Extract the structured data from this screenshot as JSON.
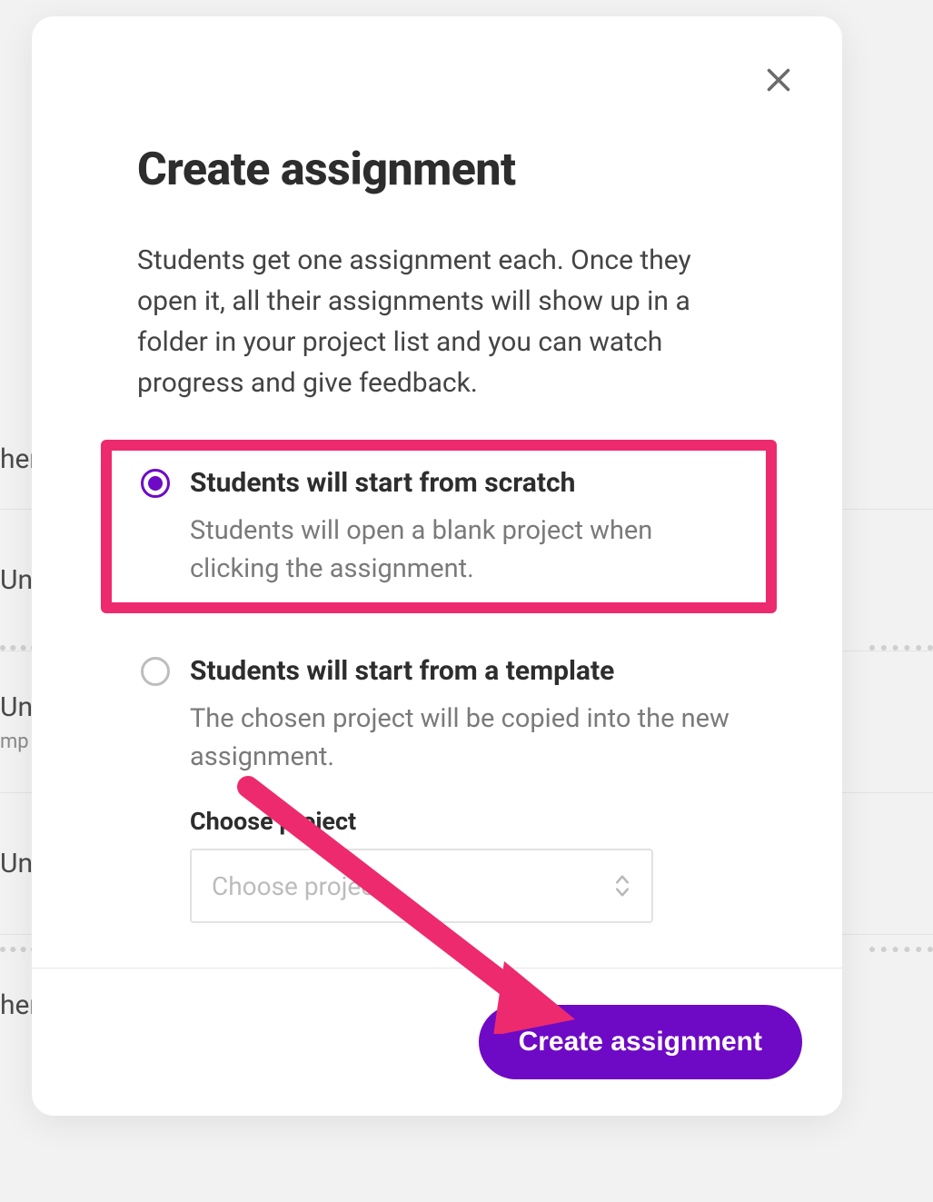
{
  "background": {
    "rows": [
      {
        "title": "her",
        "sub": ""
      },
      {
        "title": "Unt",
        "sub": ""
      },
      {
        "title": "Unt",
        "sub": "mp"
      },
      {
        "title": "Unt",
        "sub": ""
      },
      {
        "title": "her",
        "sub": ""
      }
    ]
  },
  "modal": {
    "close_label": "Close",
    "title": "Create assignment",
    "description": "Students get one assignment each. Once they open it, all their assignments will show up in a folder in your project list and you can watch progress and give feedback.",
    "options": [
      {
        "id": "scratch",
        "title": "Students will start from scratch",
        "description": "Students will open a blank project when clicking the assignment.",
        "selected": true,
        "highlighted": true
      },
      {
        "id": "template",
        "title": "Students will start from a template",
        "description": "The chosen project will be copied into the new assignment.",
        "selected": false,
        "highlighted": false,
        "field_label": "Choose project",
        "select_placeholder": "Choose project..."
      }
    ],
    "primary_button": "Create assignment"
  },
  "annotation": {
    "highlight_color": "#ed2a6e",
    "arrow_color": "#ed2a6e"
  }
}
